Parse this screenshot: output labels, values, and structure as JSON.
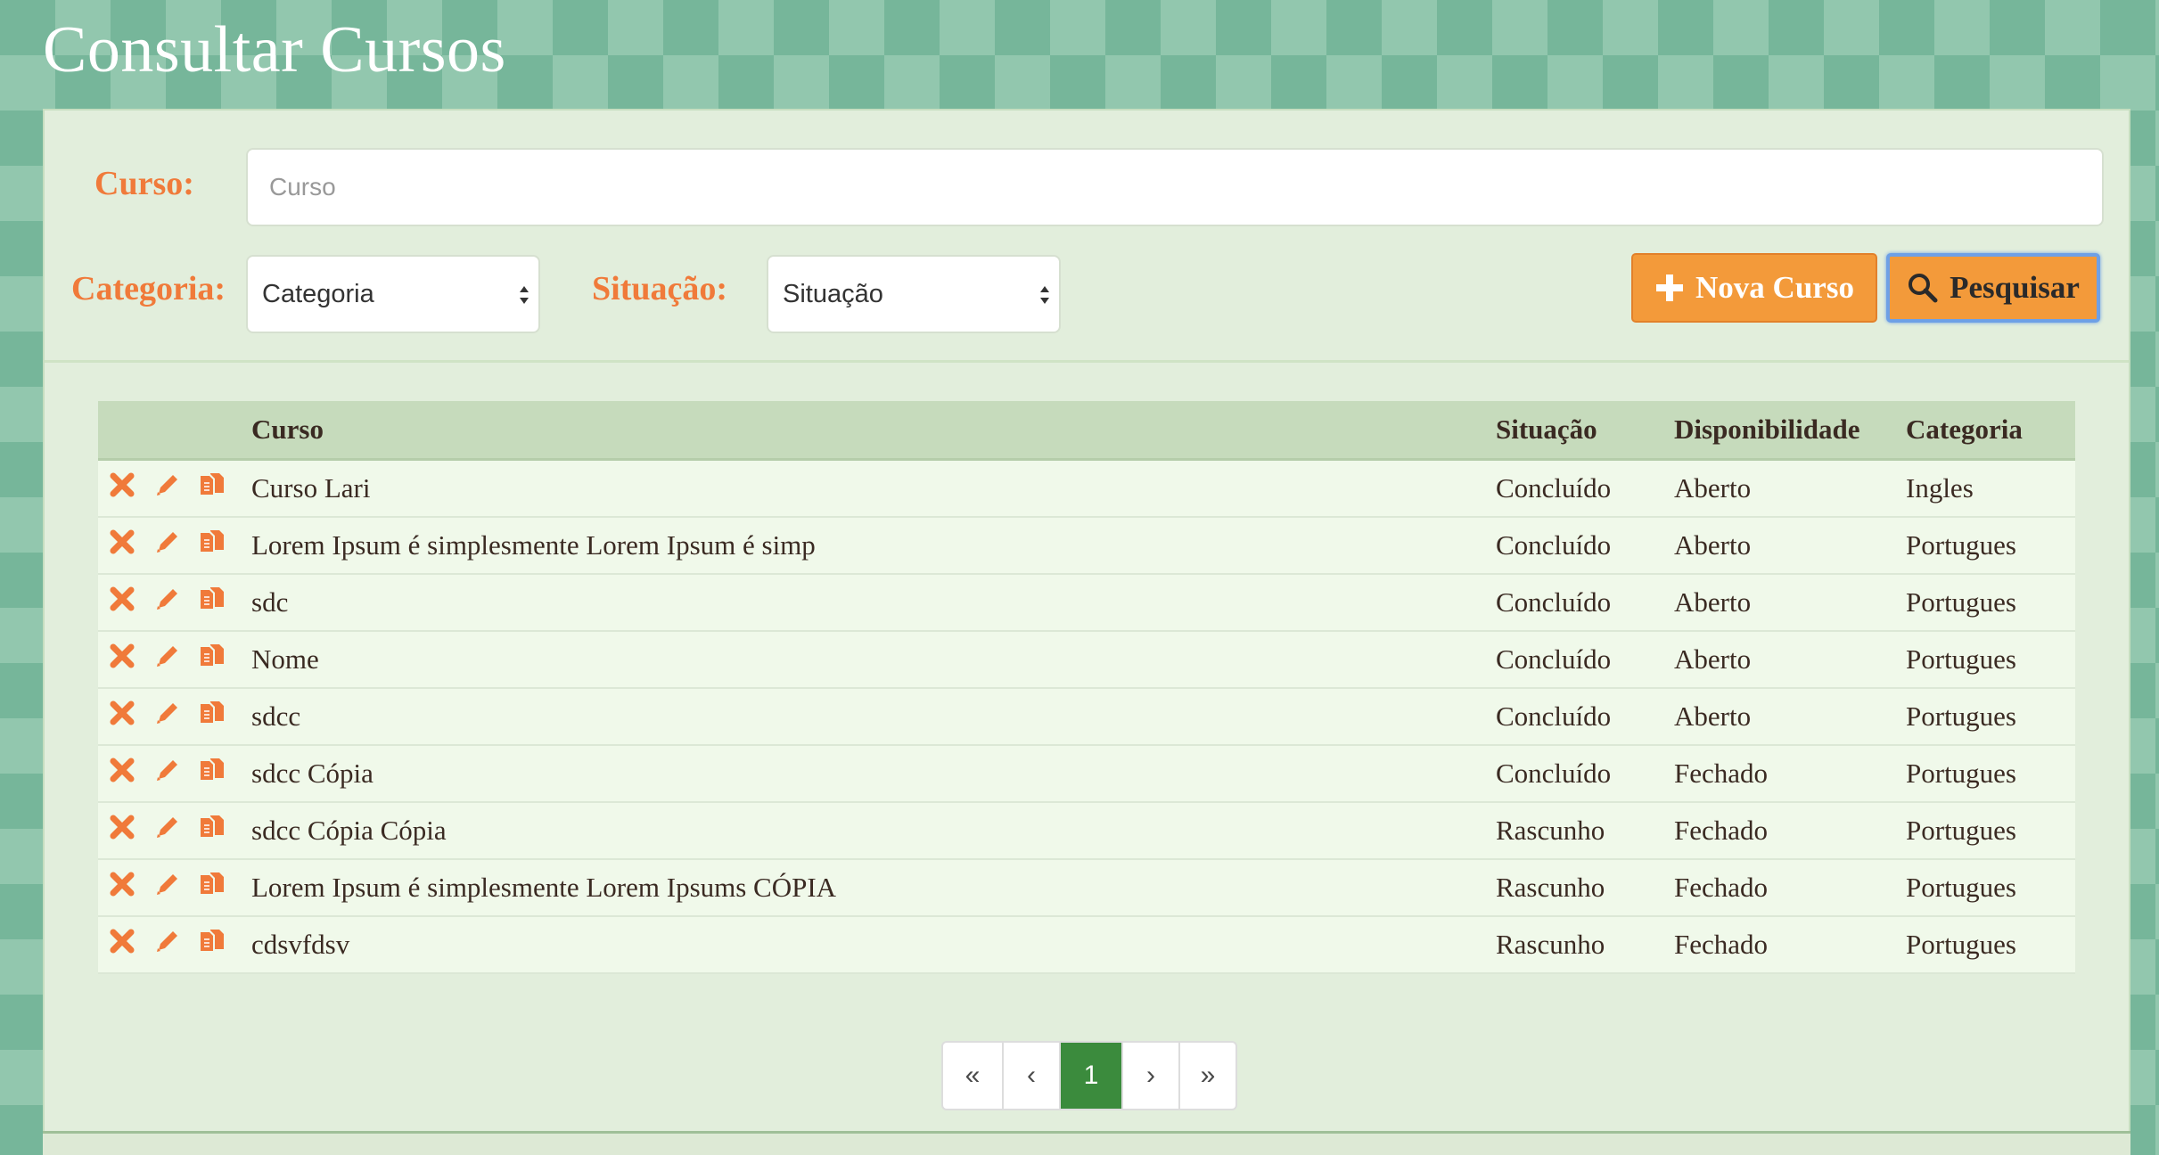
{
  "page": {
    "title": "Consultar Cursos"
  },
  "filters": {
    "curso_label": "Curso:",
    "curso_placeholder": "Curso",
    "categoria_label": "Categoria:",
    "categoria_value": "Categoria",
    "situacao_label": "Situação:",
    "situacao_value": "Situação"
  },
  "buttons": {
    "nova": "Nova Curso",
    "pesquisar": "Pesquisar"
  },
  "table": {
    "headers": [
      "Curso",
      "Situação",
      "Disponibilidade",
      "Categoria"
    ],
    "rows": [
      {
        "curso": "Curso Lari",
        "situacao": "Concluído",
        "disponibilidade": "Aberto",
        "categoria": "Ingles"
      },
      {
        "curso": "Lorem Ipsum é simplesmente Lorem Ipsum é simp",
        "situacao": "Concluído",
        "disponibilidade": "Aberto",
        "categoria": "Portugues"
      },
      {
        "curso": "sdc",
        "situacao": "Concluído",
        "disponibilidade": "Aberto",
        "categoria": "Portugues"
      },
      {
        "curso": "Nome",
        "situacao": "Concluído",
        "disponibilidade": "Aberto",
        "categoria": "Portugues"
      },
      {
        "curso": "sdcc",
        "situacao": "Concluído",
        "disponibilidade": "Aberto",
        "categoria": "Portugues"
      },
      {
        "curso": "sdcc Cópia",
        "situacao": "Concluído",
        "disponibilidade": "Fechado",
        "categoria": "Portugues"
      },
      {
        "curso": "sdcc Cópia Cópia",
        "situacao": "Rascunho",
        "disponibilidade": "Fechado",
        "categoria": "Portugues"
      },
      {
        "curso": "Lorem Ipsum é simplesmente Lorem Ipsums CÓPIA",
        "situacao": "Rascunho",
        "disponibilidade": "Fechado",
        "categoria": "Portugues"
      },
      {
        "curso": "cdsvfdsv",
        "situacao": "Rascunho",
        "disponibilidade": "Fechado",
        "categoria": "Portugues"
      }
    ]
  },
  "pagination": {
    "first": "«",
    "prev": "‹",
    "current": "1",
    "next": "›",
    "last": "»"
  },
  "icons": {
    "delete": "close-icon",
    "edit": "pencil-icon",
    "copy": "copy-icon",
    "add": "plus-icon",
    "search": "search-icon"
  },
  "colors": {
    "accent": "#f07a3a",
    "button": "#f39a3a",
    "active_page": "#3b8b3d"
  }
}
